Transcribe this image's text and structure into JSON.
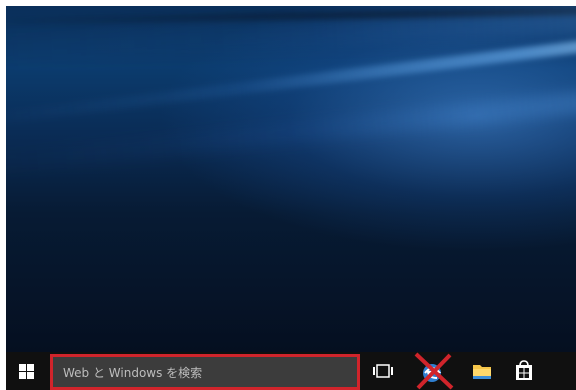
{
  "taskbar": {
    "search": {
      "placeholder": "Web と Windows を検索",
      "highlight_color": "#d0242b"
    },
    "icons": [
      {
        "name": "windows-logo-icon"
      },
      {
        "name": "task-view-icon"
      },
      {
        "name": "edge-browser-icon",
        "crossed_out": true,
        "cross_color": "#d0242b"
      },
      {
        "name": "file-explorer-icon"
      },
      {
        "name": "store-icon"
      }
    ]
  },
  "colors": {
    "taskbar": "#101010",
    "search_box": "#3c3c3c",
    "desktop_blue": "#0b3b6d"
  }
}
